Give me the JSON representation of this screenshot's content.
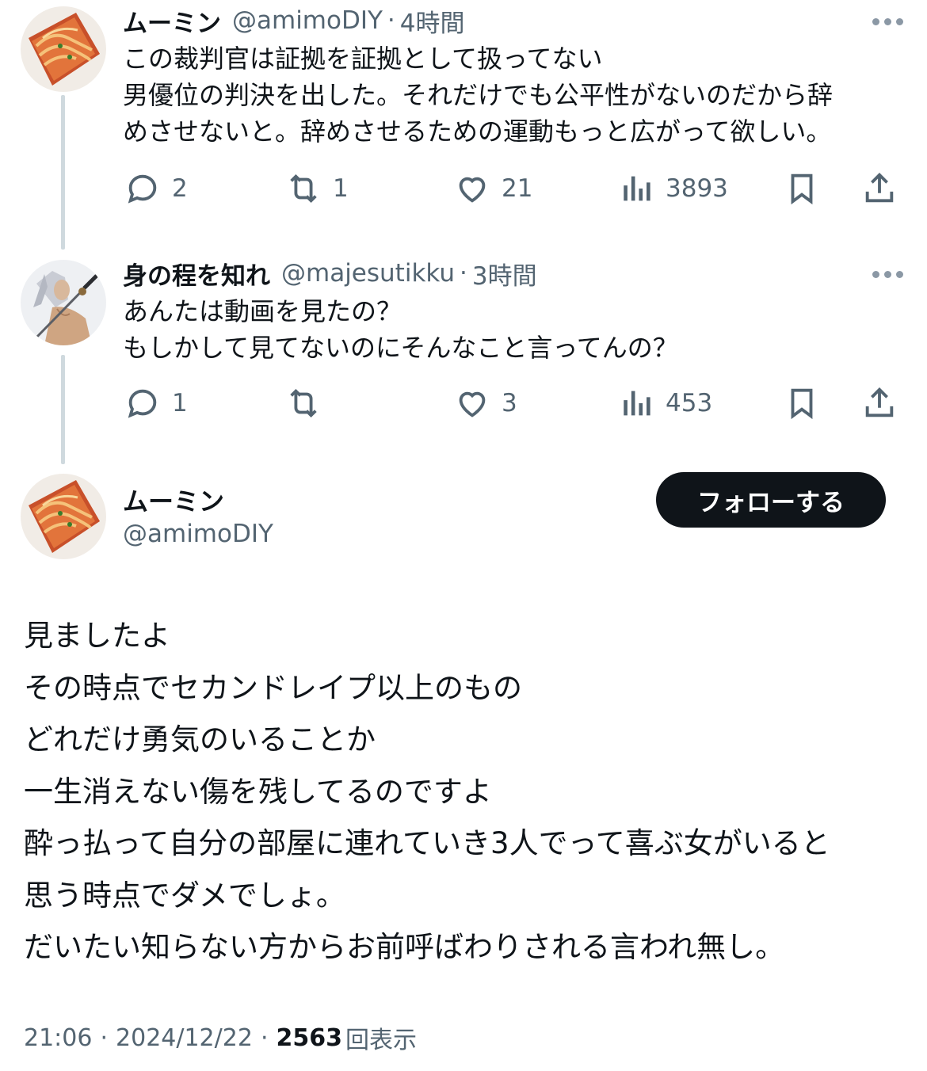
{
  "tweets": [
    {
      "name": "ムーミン",
      "handle": "@amimoDIY",
      "dot": "·",
      "time": "4時間",
      "avatar_icon": "avatar-food-image",
      "lines": [
        "この裁判官は証拠を証拠として扱ってない",
        "男優位の判決を出した。それだけでも公平性がないのだから辞",
        "めさせないと。辞めさせるための運動もっと広がって欲しい。"
      ],
      "replies": "2",
      "retweets": "1",
      "likes": "21",
      "views": "3893"
    },
    {
      "name": "身の程を知れ",
      "handle": "@majesutikku",
      "dot": "·",
      "time": "3時間",
      "avatar_icon": "avatar-swordsman-image",
      "lines": [
        "あんたは動画を見たの？",
        "もしかして見てないのにそんなこと言ってんの？"
      ],
      "replies": "1",
      "retweets": "",
      "likes": "3",
      "views": "453"
    }
  ],
  "main": {
    "name": "ムーミン",
    "handle": "@amimoDIY",
    "follow_label": "フォローする",
    "lines": [
      "見ましたよ",
      "その時点でセカンドレイプ以上のもの",
      "どれだけ勇気のいることか",
      "一生消えない傷を残してるのですよ",
      "酔っ払って自分の部屋に連れていき3人でって喜ぶ女がいると",
      "思う時点でダメでしょ。",
      "だいたい知らない方からお前呼ばわりされる言われ無し。"
    ],
    "time": "21:06",
    "sep": "·",
    "date": "2024/12/22",
    "views_count": "2563",
    "views_label": "回表示"
  },
  "icons": [
    "reply-icon",
    "retweet-icon",
    "like-icon",
    "views-icon",
    "bookmark-icon",
    "share-icon",
    "more-icon"
  ],
  "colors": {
    "text": "#0f1419",
    "secondary": "#536471",
    "thread_line": "#cfd9de",
    "follow_bg": "#0f1419",
    "follow_text": "#ffffff"
  }
}
